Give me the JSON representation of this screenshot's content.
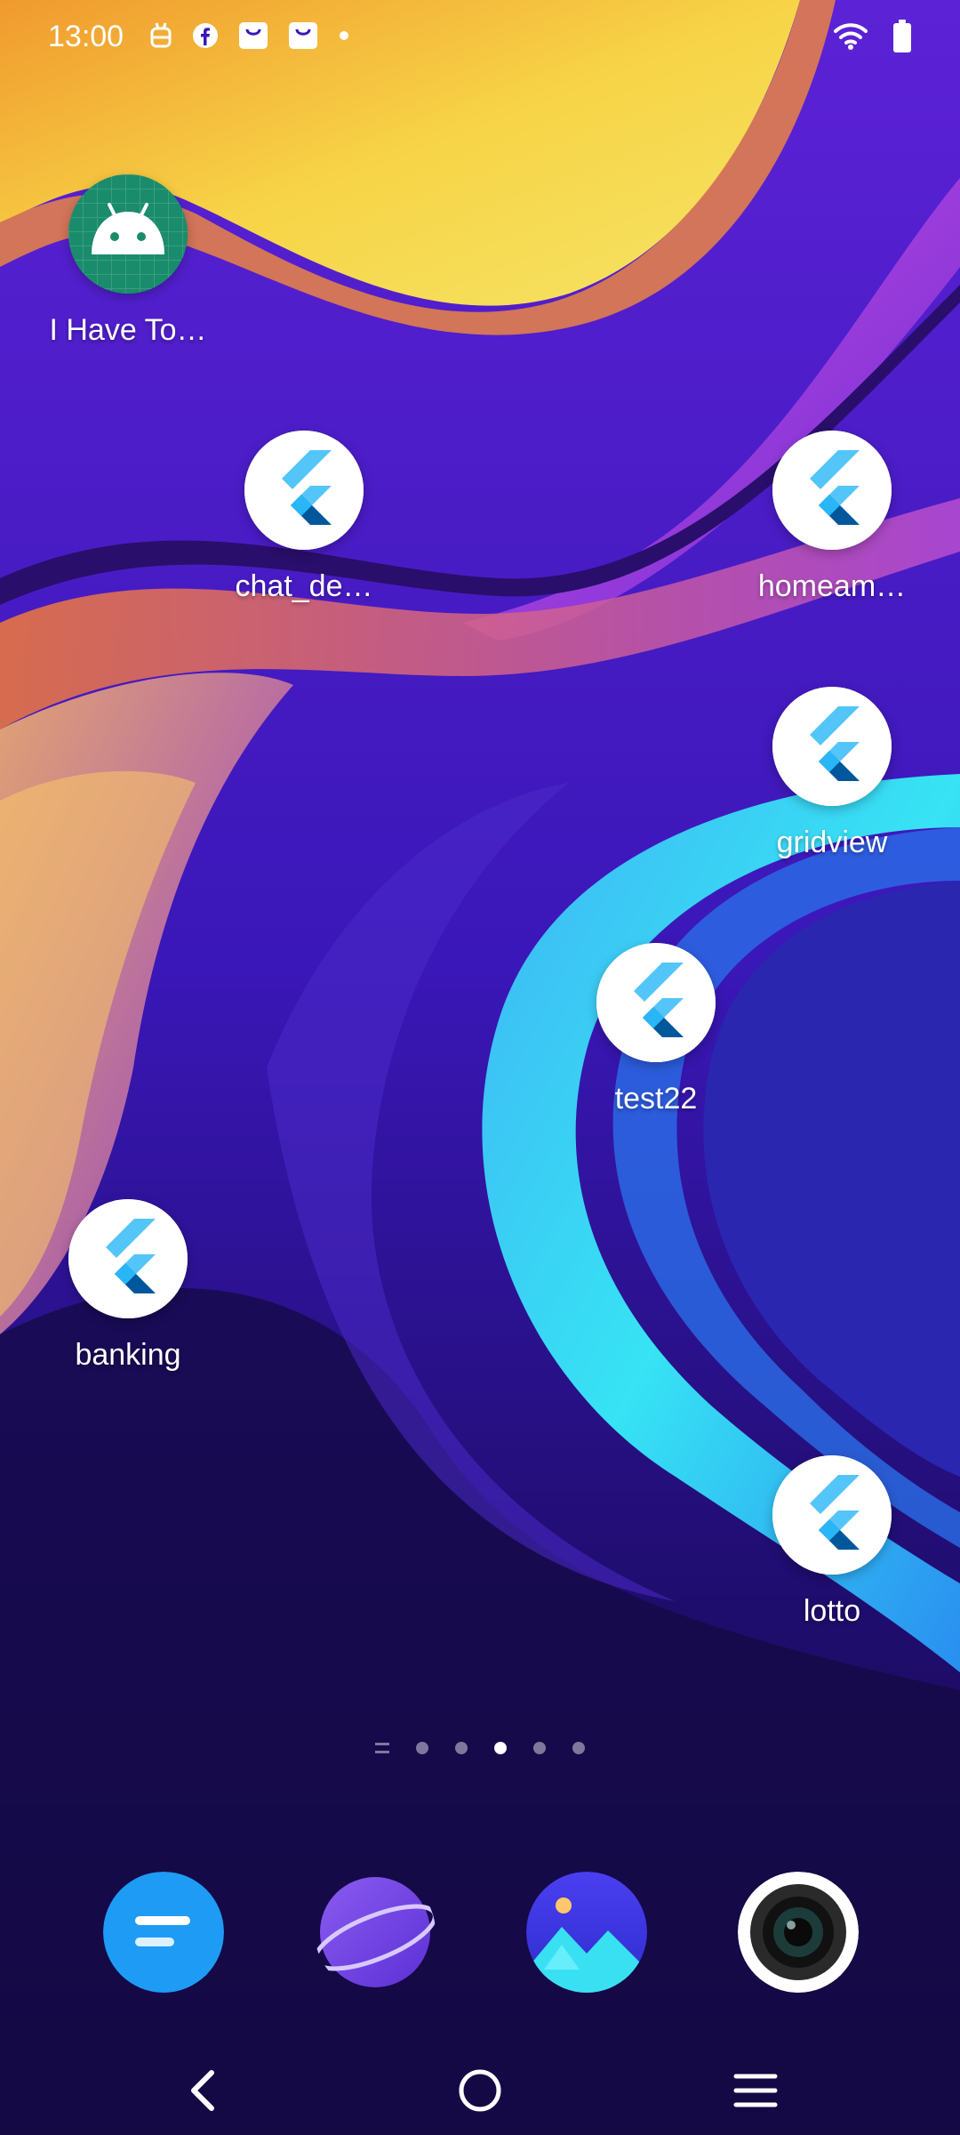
{
  "status_bar": {
    "time": "13:00",
    "notification_icons": [
      "android-notification-icon",
      "facebook-icon",
      "shopping-bag-icon",
      "shopping-bag-icon",
      "dot-icon"
    ],
    "right_icons": [
      "wifi-icon",
      "battery-icon"
    ]
  },
  "apps": [
    {
      "label": "I Have To…",
      "icon": "android-icon"
    },
    {
      "label": "chat_de…",
      "icon": "flutter-icon"
    },
    {
      "label": "homeam…",
      "icon": "flutter-icon"
    },
    {
      "label": "gridview",
      "icon": "flutter-icon"
    },
    {
      "label": "test22",
      "icon": "flutter-icon"
    },
    {
      "label": "banking",
      "icon": "flutter-icon"
    },
    {
      "label": "lotto",
      "icon": "flutter-icon"
    }
  ],
  "page_indicator": {
    "pages": 5,
    "active_page": 3
  },
  "dock": {
    "apps": [
      "messages-icon",
      "browser-planet-icon",
      "gallery-icon",
      "camera-icon"
    ]
  },
  "nav_bar": {
    "buttons": [
      "back-icon",
      "home-icon",
      "recents-menu-icon"
    ]
  },
  "colors": {
    "background_purple": "#3a17b8",
    "wallpaper_yellow": "#f7d447",
    "wallpaper_cyan": "#37e3f4",
    "flutter_light": "#54c5f8",
    "flutter_dark": "#01579b",
    "android_green": "#1a8c6c"
  }
}
